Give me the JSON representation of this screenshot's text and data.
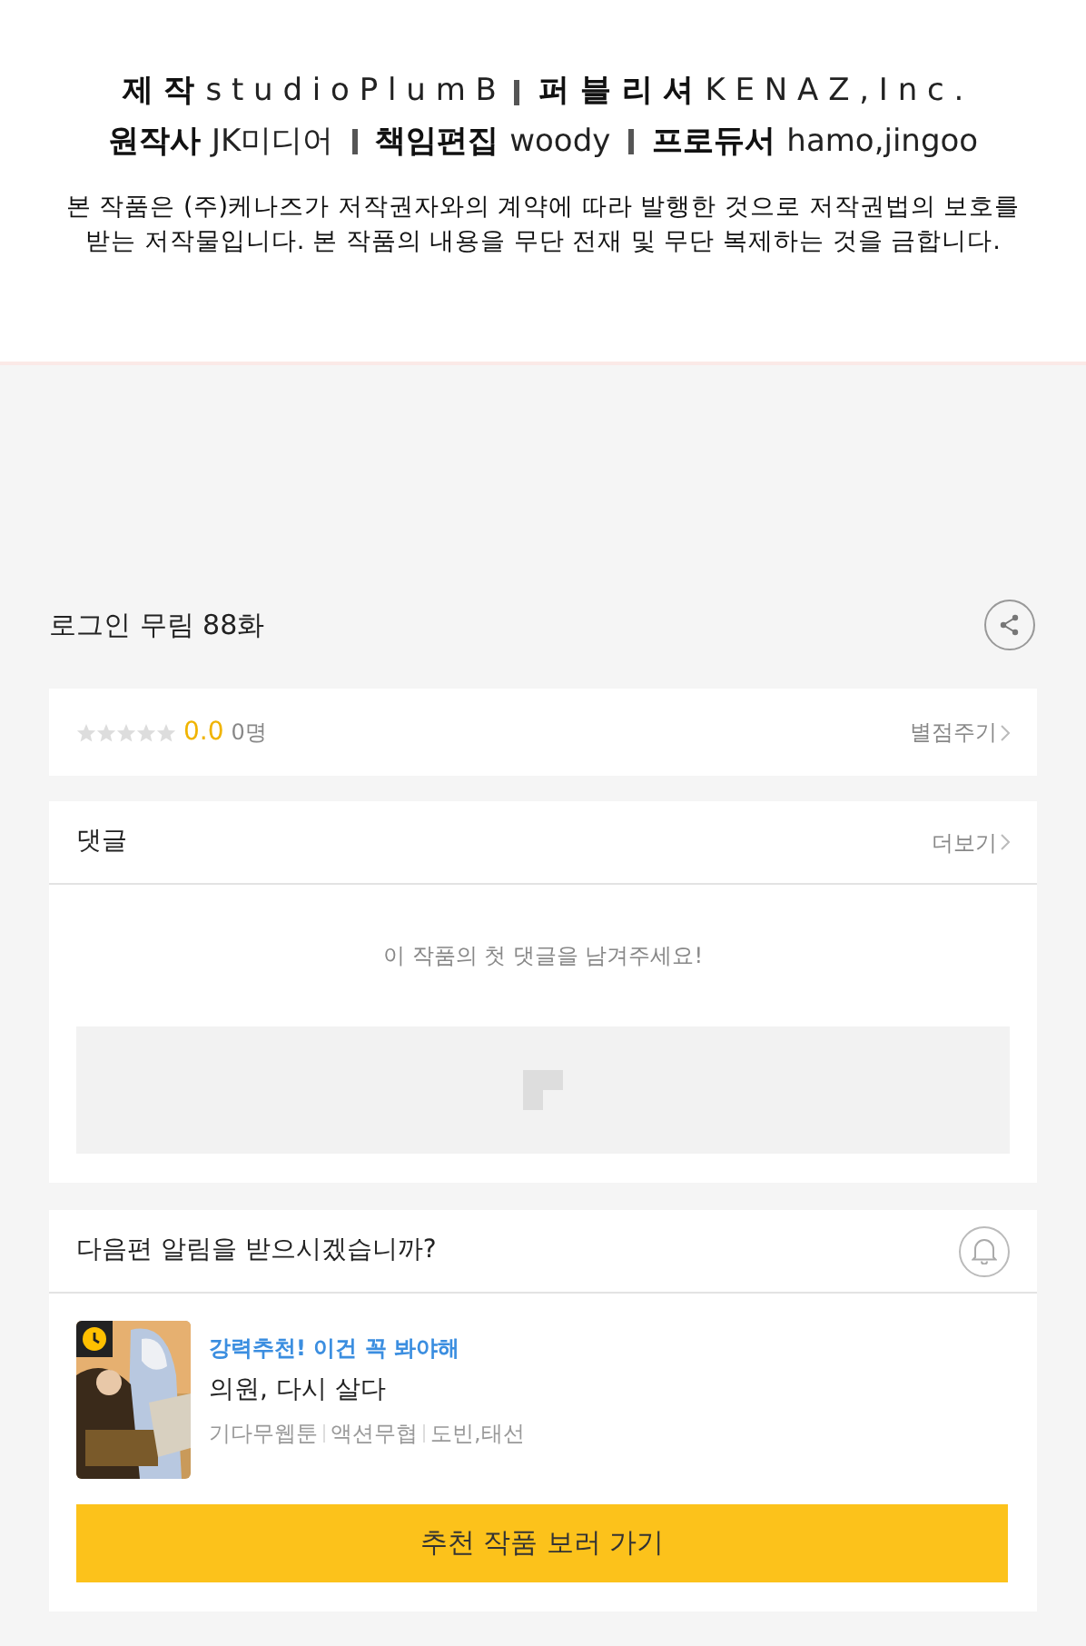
{
  "credits": {
    "lines": [
      [
        {
          "role": "제 작",
          "name": "s t u d i o P l u m B"
        },
        {
          "role": "퍼 블 리 셔",
          "name": "K E N A Z , I n c ."
        }
      ],
      [
        {
          "role": "원작사",
          "name": "JK미디어"
        },
        {
          "role": "책임편집",
          "name": "woody"
        },
        {
          "role": "프로듀서",
          "name": "hamo,jingoo"
        }
      ]
    ],
    "notice": [
      "본 작품은 (주)케나즈가 저작권자와의 계약에 따라 발행한 것으로 저작권법의 보호를",
      "받는 저작물입니다. 본 작품의 내용을 무단 전재 및 무단 복제하는 것을 금합니다."
    ]
  },
  "episode": {
    "title": "로그인 무림 88화"
  },
  "rating": {
    "stars": 0,
    "score": "0.0",
    "count": "0명",
    "action": "별점주기"
  },
  "comments": {
    "title": "댓글",
    "more": "더보기",
    "empty": "이 작품의 첫 댓글을 남겨주세요!"
  },
  "notify": {
    "question": "다음편 알림을 받으시겠습니까?",
    "subscribed": false
  },
  "recommend": {
    "tagline": "강력추천! 이건 꼭 봐야해",
    "title": "의원, 다시 살다",
    "tags": [
      "기다무웹툰",
      "액션무협",
      "도빈,태선"
    ],
    "button": "추천 작품 보러 가기"
  }
}
